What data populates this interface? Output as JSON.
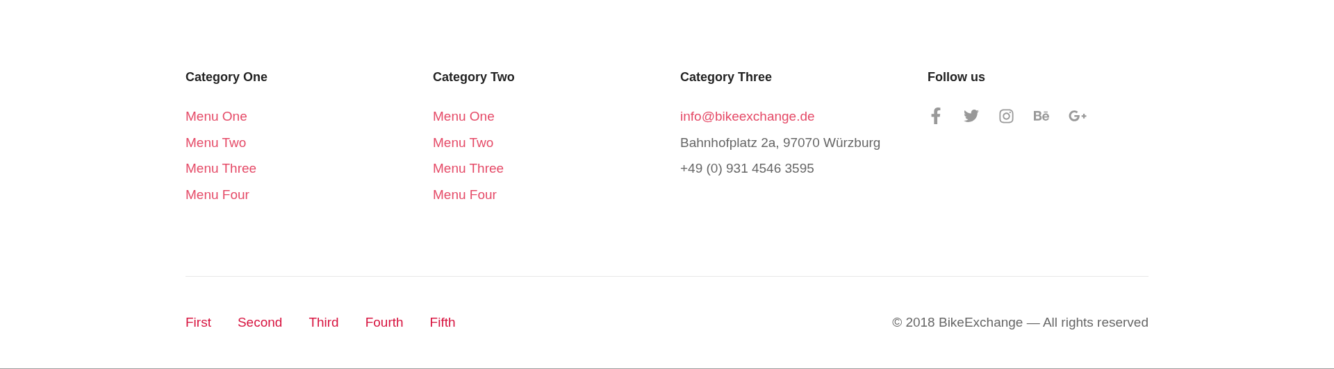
{
  "columns": [
    {
      "heading": "Category One",
      "items": [
        {
          "kind": "link",
          "text": "Menu One"
        },
        {
          "kind": "link",
          "text": "Menu Two"
        },
        {
          "kind": "link",
          "text": "Menu Three"
        },
        {
          "kind": "link",
          "text": "Menu Four"
        }
      ]
    },
    {
      "heading": "Category Two",
      "items": [
        {
          "kind": "link",
          "text": "Menu One"
        },
        {
          "kind": "link",
          "text": "Menu Two"
        },
        {
          "kind": "link",
          "text": "Menu Three"
        },
        {
          "kind": "link",
          "text": "Menu Four"
        }
      ]
    },
    {
      "heading": "Category Three",
      "items": [
        {
          "kind": "link",
          "text": "info@bikeexchange.de"
        },
        {
          "kind": "text",
          "text": "Bahnhofplatz 2a, 97070 Würzburg"
        },
        {
          "kind": "text",
          "text": "+49 (0) 931 4546 3595"
        }
      ]
    }
  ],
  "social": {
    "heading": "Follow us",
    "icons": [
      {
        "kind": "facebook"
      },
      {
        "kind": "twitter"
      },
      {
        "kind": "instagram"
      },
      {
        "kind": "behance"
      },
      {
        "kind": "googleplus"
      }
    ]
  },
  "bottom_links": [
    "First",
    "Second",
    "Third",
    "Fourth",
    "Fifth"
  ],
  "copyright": "© 2018 BikeExchange — All rights reserved"
}
